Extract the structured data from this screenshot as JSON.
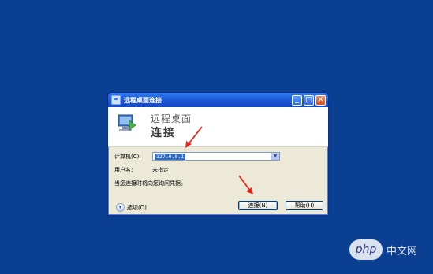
{
  "window": {
    "title": "远程桌面连接",
    "banner_line1": "远程桌面",
    "banner_line2": "连接"
  },
  "form": {
    "computer_label": "计算机(C):",
    "computer_value": "127.0.0.1",
    "username_label": "用户名:",
    "username_value": "未指定",
    "info_text": "当您连接时将向您询问凭据。"
  },
  "buttons": {
    "options": "选项(O)",
    "connect": "连接(N)",
    "help": "帮助(H)"
  },
  "watermark": {
    "logo": "php",
    "text": "中文网"
  },
  "colors": {
    "desktop": "#0a3f91",
    "titlebar": "#1a55d6",
    "annotation_arrow": "#e8261c"
  }
}
